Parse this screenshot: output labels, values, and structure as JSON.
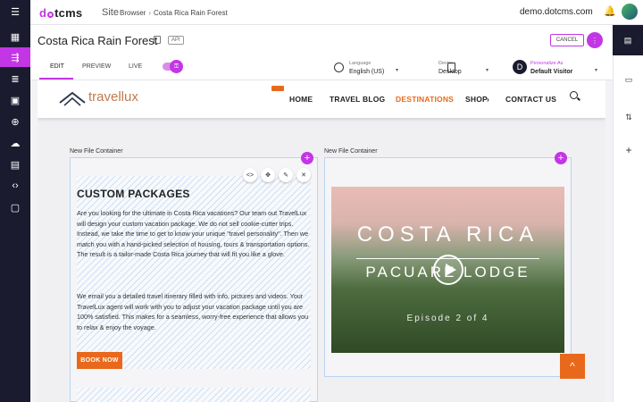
{
  "topbar": {
    "logo_a": "d",
    "logo_b": "tcms",
    "site_label": "Site",
    "crumb1": "Browser",
    "crumb_sep": "›",
    "crumb2": "Costa Rica Rain Forest",
    "host": "demo.dotcms.com"
  },
  "leftnav": {
    "items": [
      {
        "icon": "menu-icon",
        "glyph": "☰"
      },
      {
        "icon": "dashboard-icon",
        "glyph": "▦"
      },
      {
        "icon": "site-tree-icon",
        "glyph": "⇶"
      },
      {
        "icon": "content-icon",
        "glyph": "≣"
      },
      {
        "icon": "image-icon",
        "glyph": "▣"
      },
      {
        "icon": "rules-icon",
        "glyph": "⊕"
      },
      {
        "icon": "cloud-icon",
        "glyph": "☁"
      },
      {
        "icon": "calendar-icon",
        "glyph": "▤"
      },
      {
        "icon": "code-icon",
        "glyph": "‹›"
      },
      {
        "icon": "settings-icon",
        "glyph": "▢"
      }
    ]
  },
  "titlebar": {
    "title": "Costa Rica Rain Forest",
    "api_badge": "API",
    "cancel_label": "CANCEL",
    "more_glyph": "⋮"
  },
  "modebar": {
    "tabs": [
      "EDIT",
      "PREVIEW",
      "LIVE"
    ],
    "lock_glyph": "🔒",
    "language_label": "Language",
    "language_value": "English (US)",
    "device_label": "Device",
    "device_value": "Desktop",
    "personalize_label": "Personalize As",
    "personalize_value": "Default Visitor",
    "persona_initial": "D",
    "caret": "▾"
  },
  "rightpanel": {
    "items": [
      {
        "icon": "page-icon",
        "glyph": "▤"
      },
      {
        "icon": "layout-icon",
        "glyph": "▭"
      },
      {
        "icon": "sliders-icon",
        "glyph": "⇅"
      },
      {
        "icon": "add-icon",
        "glyph": "+"
      }
    ]
  },
  "site": {
    "logo": "travellux",
    "nav": [
      "HOME",
      "TRAVEL BLOG",
      "DESTINATIONS",
      "SHOP",
      "CONTACT US"
    ],
    "shop_caret": "›"
  },
  "containers": {
    "label_left": "New File Container",
    "label_right": "New File Container",
    "plus": "+"
  },
  "content": {
    "title": "CUSTOM PACKAGES",
    "p1": "Are you looking for the ultimate in Costa Rica vacations? Our team out TravelLux will design your custom vacation package. We do not sell cookie-cutter trips. Instead, we take the time to get to know your unique \"travel personality\". Then we match you with a hand-picked selection of housing, tours & transportation options. The result is a tailor-made Costa Rica journey that will fit you like a glove.",
    "p2": "We email you a detailed travel itinerary filled with info, pictures and videos. Your TravelLux agent will work with you to adjust your vacation package until you are 100% satisfied. This makes for a seamless, worry-free experience that allows you to relax & enjoy the voyage.",
    "book_label": "BOOK NOW",
    "toolbar": {
      "code": "<>",
      "drag": "✥",
      "edit": "✎",
      "close": "✕"
    }
  },
  "video": {
    "title": "COSTA RICA",
    "subtitle": "PACUARE LODGE",
    "episode": "Episode 2 of 4"
  },
  "scroll_top": "^"
}
